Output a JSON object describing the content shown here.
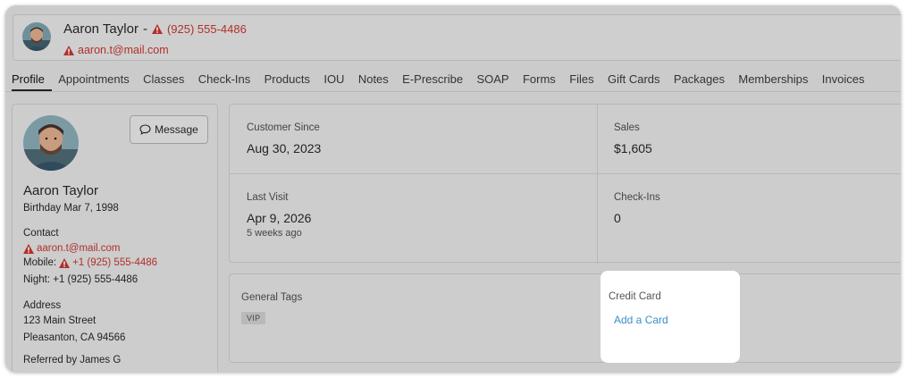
{
  "header": {
    "name": "Aaron Taylor",
    "separator": "-",
    "phone": "(925) 555-4486",
    "email": "aaron.t@mail.com"
  },
  "tabs": [
    {
      "label": "Profile",
      "active": true
    },
    {
      "label": "Appointments"
    },
    {
      "label": "Classes"
    },
    {
      "label": "Check-Ins"
    },
    {
      "label": "Products"
    },
    {
      "label": "IOU"
    },
    {
      "label": "Notes"
    },
    {
      "label": "E-Prescribe"
    },
    {
      "label": "SOAP"
    },
    {
      "label": "Forms"
    },
    {
      "label": "Files"
    },
    {
      "label": "Gift Cards"
    },
    {
      "label": "Packages"
    },
    {
      "label": "Memberships"
    },
    {
      "label": "Invoices"
    }
  ],
  "profile": {
    "message_label": "Message",
    "name": "Aaron Taylor",
    "birthday": "Birthday Mar 7, 1998",
    "contact_heading": "Contact",
    "email": "aaron.t@mail.com",
    "mobile_label": "Mobile:",
    "mobile": "+1 (925) 555-4486",
    "night": "Night: +1 (925) 555-4486",
    "address_heading": "Address",
    "address_line1": "123 Main Street",
    "address_line2": "Pleasanton, CA 94566",
    "referred": "Referred by James G"
  },
  "stats": {
    "customer_since_label": "Customer Since",
    "customer_since_value": "Aug 30, 2023",
    "sales_label": "Sales",
    "sales_value": "$1,605",
    "last_visit_label": "Last Visit",
    "last_visit_value": "Apr 9, 2026",
    "last_visit_sub": "5 weeks ago",
    "checkins_label": "Check-Ins",
    "checkins_value": "0"
  },
  "tags": {
    "label": "General Tags",
    "items": [
      "VIP"
    ]
  },
  "credit_card": {
    "label": "Credit Card",
    "add_label": "Add a Card"
  },
  "colors": {
    "warning_red": "#b0302a",
    "link_blue": "#3a8fc8",
    "dimmed_bg": "#cdcdcd"
  }
}
